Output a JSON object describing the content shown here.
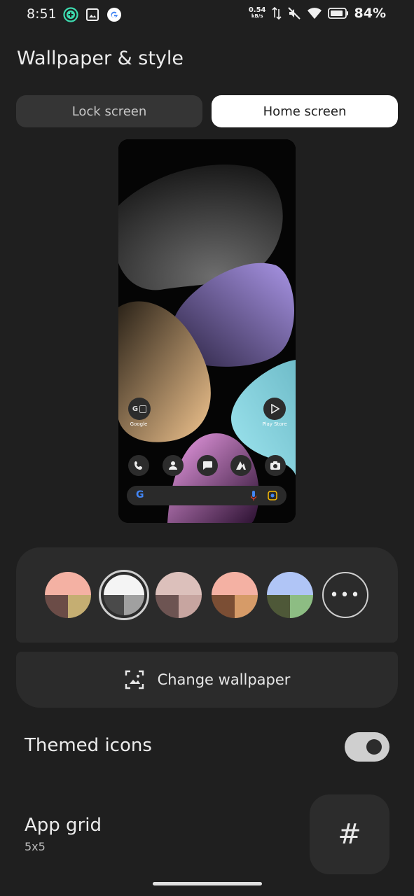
{
  "status_bar": {
    "time": "8:51",
    "net_speed_value": "0.54",
    "net_speed_unit": "kB/s",
    "battery_percent": "84%"
  },
  "page_title": "Wallpaper & style",
  "tabs": [
    {
      "label": "Lock screen",
      "selected": false
    },
    {
      "label": "Home screen",
      "selected": true
    }
  ],
  "preview": {
    "apps_row": [
      {
        "label": "Google"
      },
      {
        "label": "Play Store"
      }
    ],
    "dock_icons": [
      "phone-icon",
      "contacts-icon",
      "messages-icon",
      "app-icon",
      "camera-icon"
    ]
  },
  "palettes": [
    {
      "top": "#f4b1a3",
      "bl": "#6b4c47",
      "br": "#c5ae72",
      "selected": false
    },
    {
      "top": "#f4f4f4",
      "bl": "#4a4a4a",
      "br": "#a0a0a0",
      "selected": true
    },
    {
      "top": "#dcc0bb",
      "bl": "#6d5452",
      "br": "#c7a5a0",
      "selected": false
    },
    {
      "top": "#f4b1a3",
      "bl": "#7b4e34",
      "br": "#d69b68",
      "selected": false
    },
    {
      "top": "#b0c5f6",
      "bl": "#4e5838",
      "br": "#8dbd83",
      "selected": false
    }
  ],
  "more_colors_label": "•••",
  "change_wallpaper_label": "Change wallpaper",
  "themed_icons": {
    "label": "Themed icons",
    "enabled": true
  },
  "app_grid": {
    "label": "App grid",
    "value": "5x5"
  }
}
